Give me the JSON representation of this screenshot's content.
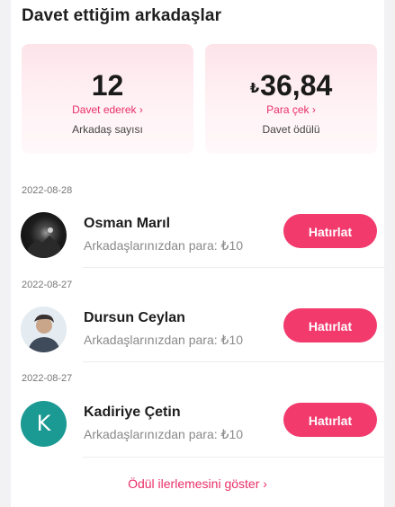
{
  "section_title": "Davet ettiğim arkadaşlar",
  "stats": {
    "friends": {
      "value": "12",
      "link": "Davet ederek ›",
      "caption": "Arkadaş sayısı"
    },
    "reward": {
      "currency": "₺",
      "value": "36,84",
      "link": "Para çek ›",
      "caption": "Davet ödülü"
    }
  },
  "friends": [
    {
      "date": "2022-08-28",
      "name": "Osman Marıl",
      "subtitle": "Arkadaşlarınızdan para: ₺10",
      "button": "Hatırlat"
    },
    {
      "date": "2022-08-27",
      "name": "Dursun Ceylan",
      "subtitle": "Arkadaşlarınızdan para: ₺10",
      "button": "Hatırlat"
    },
    {
      "date": "2022-08-27",
      "name": "Kadiriye Çetin",
      "subtitle": "Arkadaşlarınızdan para: ₺10",
      "button": "Hatırlat",
      "initial": "K"
    }
  ],
  "footer_link": "Ödül ilerlemesini göster ›",
  "colors": {
    "accent": "#f23a6d",
    "link": "#ea2f66",
    "avatar_k": "#1b9a94"
  }
}
